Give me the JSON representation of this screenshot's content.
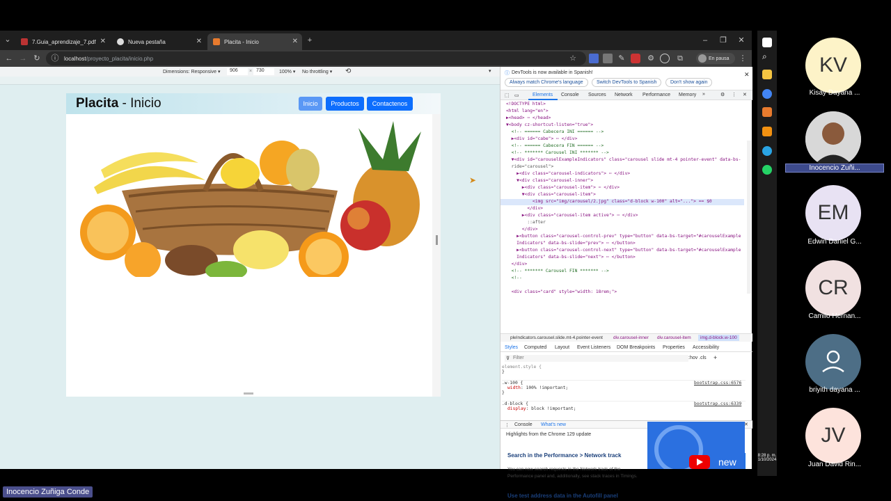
{
  "browser": {
    "tabs": [
      {
        "title": "7.Guia_aprendizaje_7.pdf"
      },
      {
        "title": "Nueva pestaña"
      },
      {
        "title": "Placita - Inicio"
      }
    ],
    "url_host": "localhost",
    "url_path": "/proyecto_placita/inicio.php",
    "profile_status": "En pausa"
  },
  "device_toolbar": {
    "dimensions": "Dimensions: Responsive",
    "width": "906",
    "height": "730",
    "zoom": "100%",
    "throttling": "No throttling"
  },
  "site": {
    "brand_bold": "Placita",
    "brand_rest": " - Inicio",
    "nav": [
      "Inicio",
      "Productos",
      "Contactenos"
    ]
  },
  "devtools": {
    "banner": "DevTools is now available in Spanish!",
    "banner_buttons": [
      "Always match Chrome's language",
      "Switch DevTools to Spanish",
      "Don't show again"
    ],
    "tabs": [
      "Elements",
      "Console",
      "Sources",
      "Network",
      "Performance",
      "Memory"
    ],
    "code_lines": [
      "<!DOCTYPE html>",
      "<html lang=\"en\">",
      "▶<head> ⋯ </head>",
      "▼<body cz-shortcut-listen=\"true\">",
      "  <!-- ====== Cabecera INI ====== -->",
      "  ▶<div id=\"cabe\"> ⋯ </div>",
      "  <!-- ====== Cabecera FIN ====== -->",
      "  <!-- ******* Carousel INI ******* -->",
      "  ▼<div id=\"carouselExampleIndicators\" class=\"carousel slide mt-4 pointer-event\" data-bs-",
      "  ride=\"carousel\">",
      "    ▶<div class=\"carousel-indicators\"> ⋯ </div>",
      "    ▼<div class=\"carousel-inner\">",
      "      ▶<div class=\"carousel-item\"> ⋯ </div>",
      "      ▼<div class=\"carousel-item\">",
      "          <img src=\"img/carousel/2.jpg\" class=\"d-block w-100\" alt=\"...\"> == $0",
      "        </div>",
      "      ▶<div class=\"carousel-item active\"> ⋯ </div>",
      "        ::after",
      "      </div>",
      "    ▶<button class=\"carousel-control-prev\" type=\"button\" data-bs-target=\"#carouselExample",
      "    Indicators\" data-bs-slide=\"prev\"> ⋯ </button>",
      "    ▶<button class=\"carousel-control-next\" type=\"button\" data-bs-target=\"#carouselExample",
      "    Indicators\" data-bs-slide=\"next\"> ⋯ </button>",
      "  </div>",
      "  <!-- ******* Carousel FIN ******* -->",
      "  <!--",
      "",
      "  <div class=\"card\" style=\"width: 18rem;\">"
    ],
    "breadcrumbs": [
      "pleIndicators.carousel.slide.mt-4.pointer-event",
      "div.carousel-inner",
      "div.carousel-item",
      "img.d-block.w-100"
    ],
    "styles_tabs": [
      "Styles",
      "Computed",
      "Layout",
      "Event Listeners",
      "DOM Breakpoints",
      "Properties",
      "Accessibility"
    ],
    "filter_placeholder": "Filter",
    "filter_opts": ":hov .cls",
    "rules": [
      {
        "selector": "element.style {",
        "body": "}",
        "source": ""
      },
      {
        "selector": ".w-100 {",
        "prop": "width",
        "value": "100% !important;",
        "source": "bootstrap.css:6576"
      },
      {
        "selector": ".d-block {",
        "prop": "display",
        "value": "block !important;",
        "source": "bootstrap.css:6339"
      }
    ],
    "drawer_tabs": [
      "Console",
      "What's new"
    ],
    "drawer_highlight": "Highlights from the Chrome 129 update",
    "news1_title": "Search in the Performance > Network track",
    "news1_body": "You can now search requests in the Network track of the Performance panel and, additionally, see stack traces in Timings.",
    "news2_title": "Use test address data in the Autofill panel",
    "news_badge": "new"
  },
  "participants": [
    {
      "initials": "KV",
      "name": "Kisay Dayana ...",
      "color": "#fdf3c8"
    },
    {
      "initials": "",
      "name": "Inocencio Zuñi...",
      "color": "#d8d8d8"
    },
    {
      "initials": "EM",
      "name": "Edwin Daniel G...",
      "color": "#e8e2f3"
    },
    {
      "initials": "CR",
      "name": "Camilo Hernan...",
      "color": "#f1e1e1"
    },
    {
      "initials": "",
      "name": "briyith dayana ...",
      "color": "#4d6e86"
    },
    {
      "initials": "JV",
      "name": "Juan David Rin...",
      "color": "#fde3dc"
    }
  ],
  "clock": {
    "time": "8:28 p. m.",
    "date": "1/10/2024"
  },
  "speaker": "Inocencio Zuñiga Conde"
}
